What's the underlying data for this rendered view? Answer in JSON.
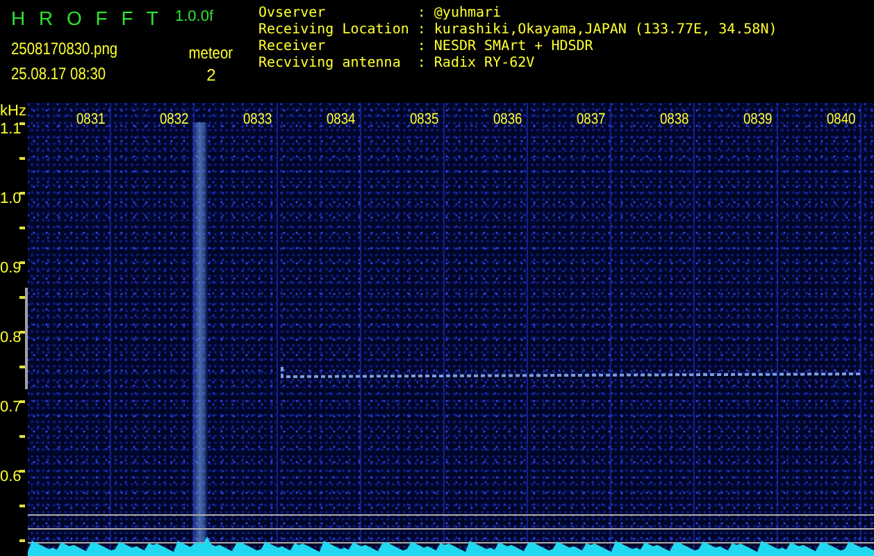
{
  "app": {
    "name": "H R O F F T",
    "version": "1.0.0f"
  },
  "file": {
    "name": "2508170830.png",
    "datetime": "25.08.17 08:30"
  },
  "detection": {
    "label": "meteor",
    "count": "2"
  },
  "station_info": [
    {
      "label": "Ovserver",
      "separator": ":",
      "value": "@yuhmari"
    },
    {
      "label": "Receiving Location",
      "separator": ":",
      "value": "kurashiki,Okayama,JAPAN (133.77E, 34.58N)"
    },
    {
      "label": "Receiver",
      "separator": ":",
      "value": "NESDR SMArt + HDSDR"
    },
    {
      "label": "Recviving antenna",
      "separator": ":",
      "value": "Radix RY-62V"
    }
  ],
  "frequency_axis": {
    "unit": "kHz",
    "labels": [
      "1.1",
      "1.0",
      "0.9",
      "0.8",
      "0.7",
      "0.6"
    ]
  },
  "time_axis": {
    "labels": [
      "0831",
      "0832",
      "0833",
      "0834",
      "0835",
      "0836",
      "0837",
      "0838",
      "0839",
      "0840"
    ]
  }
}
